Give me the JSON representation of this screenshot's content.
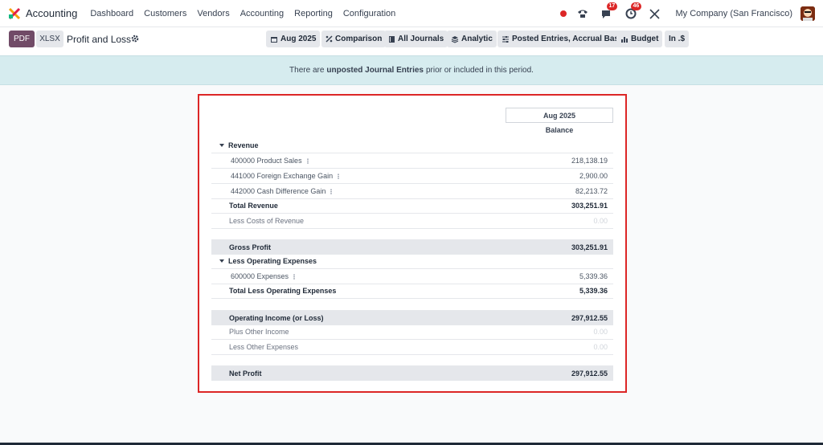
{
  "nav": {
    "app_name": "Accounting",
    "menu": [
      "Dashboard",
      "Customers",
      "Vendors",
      "Accounting",
      "Reporting",
      "Configuration"
    ],
    "chat_badge": "17",
    "activity_badge": "46",
    "company": "My Company (San Francisco)"
  },
  "toolbar": {
    "pdf": "PDF",
    "xlsx": "XLSX",
    "title": "Profit and Loss",
    "filters": {
      "date": "Aug 2025",
      "comparison": "Comparison",
      "journals": "All Journals",
      "analytic": "Analytic",
      "entries": "Posted Entries, Accrual Basis",
      "budget": "Budget",
      "currency": "In .$"
    }
  },
  "banner": {
    "prefix": "There are",
    "bold": "unposted Journal Entries",
    "suffix": "prior or included in this period."
  },
  "report": {
    "period": "Aug 2025",
    "column": "Balance",
    "rows": [
      {
        "label": "Revenue",
        "value": ""
      },
      {
        "label": "400000 Product Sales",
        "value": "218,138.19"
      },
      {
        "label": "441000 Foreign Exchange Gain",
        "value": "2,900.00"
      },
      {
        "label": "442000 Cash Difference Gain",
        "value": "82,213.72"
      },
      {
        "label": "Total Revenue",
        "value": "303,251.91"
      },
      {
        "label": "Less Costs of Revenue",
        "value": "0.00"
      },
      {
        "label": "Gross Profit",
        "value": "303,251.91"
      },
      {
        "label": "Less Operating Expenses",
        "value": ""
      },
      {
        "label": "600000 Expenses",
        "value": "5,339.36"
      },
      {
        "label": "Total Less Operating Expenses",
        "value": "5,339.36"
      },
      {
        "label": "Operating Income (or Loss)",
        "value": "297,912.55"
      },
      {
        "label": "Plus Other Income",
        "value": "0.00"
      },
      {
        "label": "Less Other Expenses",
        "value": "0.00"
      },
      {
        "label": "Net Profit",
        "value": "297,912.55"
      }
    ]
  },
  "colors": {
    "brand": "#714b67",
    "banner": "#d6ecef",
    "highlight_border": "#dc2626",
    "badge": "#dc2626"
  }
}
